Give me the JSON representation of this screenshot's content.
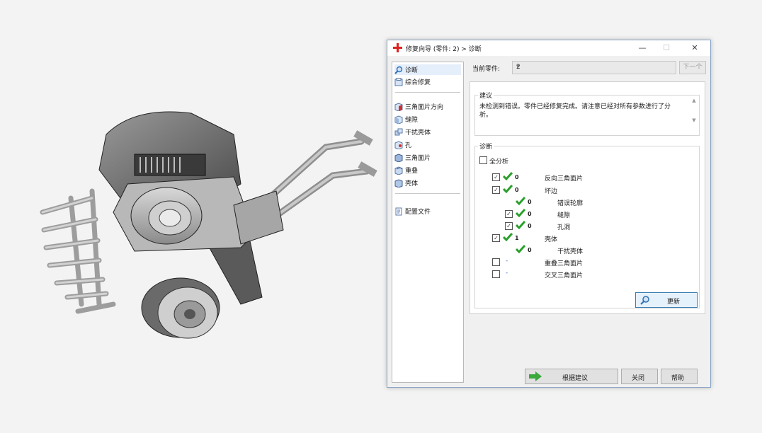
{
  "window": {
    "title": "修复向导 (零件: 2) > 诊断",
    "minimize": "—",
    "maximize": "☐",
    "close": "✕"
  },
  "sidebar": {
    "items": [
      {
        "label": "诊断",
        "icon": "magnifier-icon"
      },
      {
        "label": "综合修复",
        "icon": "repair-icon"
      },
      {
        "label": "三角面片方向",
        "icon": "triangle-direction-icon"
      },
      {
        "label": "缝隙",
        "icon": "gap-icon"
      },
      {
        "label": "干扰壳体",
        "icon": "interfering-shell-icon"
      },
      {
        "label": "孔",
        "icon": "hole-icon"
      },
      {
        "label": "三角面片",
        "icon": "triangle-icon"
      },
      {
        "label": "重叠",
        "icon": "overlap-icon"
      },
      {
        "label": "壳体",
        "icon": "shell-icon"
      },
      {
        "label": "配置文件",
        "icon": "profile-icon"
      }
    ]
  },
  "current_part": {
    "label": "当前零件:",
    "value": "2",
    "next_label": "下一个"
  },
  "suggestion": {
    "title": "建议",
    "text": "未检测到错误。零件已经修复完成。请注意已经对所有参数进行了分析。"
  },
  "diagnosis": {
    "title": "诊断",
    "full_analysis": "全分析",
    "rows": [
      {
        "checked": true,
        "status": "ok",
        "count": "0",
        "label": "反向三角面片"
      },
      {
        "checked": true,
        "status": "ok",
        "count": "0",
        "label": "坏边"
      },
      {
        "checked": null,
        "status": "ok",
        "count": "0",
        "label": "错误轮廓"
      },
      {
        "checked": true,
        "status": "ok",
        "count": "0",
        "label": "缝隙"
      },
      {
        "checked": true,
        "status": "ok",
        "count": "0",
        "label": "孔洞"
      },
      {
        "checked": true,
        "status": "ok",
        "count": "1",
        "label": "壳体"
      },
      {
        "checked": null,
        "status": "ok",
        "count": "0",
        "label": "干扰壳体"
      },
      {
        "checked": false,
        "status": "none",
        "count": "-",
        "label": "重叠三角面片"
      },
      {
        "checked": false,
        "status": "none",
        "count": "-",
        "label": "交叉三角面片"
      }
    ],
    "update_label": "更新"
  },
  "buttons": {
    "follow": "根据建议",
    "close": "关闭",
    "help": "帮助"
  },
  "colors": {
    "accent": "#3c7fb1",
    "ok": "#2aa02a",
    "title_icon": "#e02020",
    "arrow": "#3aa83a"
  }
}
